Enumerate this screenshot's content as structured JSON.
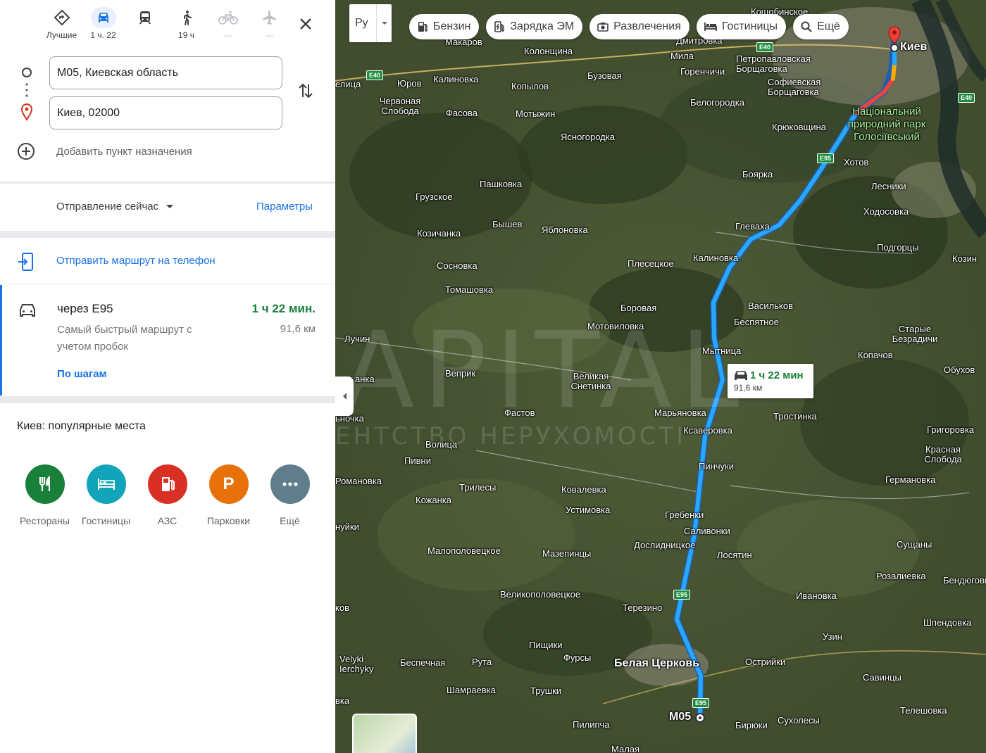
{
  "modes": [
    {
      "key": "best",
      "label": "Лучшие",
      "icon": "diamond-directions-icon",
      "selected": false,
      "dim": false
    },
    {
      "key": "car",
      "label": "1 ч. 22",
      "icon": "car-icon",
      "selected": true,
      "dim": false
    },
    {
      "key": "transit",
      "label": "",
      "icon": "train-icon",
      "selected": false,
      "dim": false
    },
    {
      "key": "walk",
      "label": "19 ч",
      "icon": "walk-icon",
      "selected": false,
      "dim": false
    },
    {
      "key": "bike",
      "label": "—",
      "icon": "bike-icon",
      "selected": false,
      "dim": true
    },
    {
      "key": "flight",
      "label": "—",
      "icon": "plane-icon",
      "selected": false,
      "dim": true
    }
  ],
  "from": {
    "value": "M05, Киевская область"
  },
  "to": {
    "value": "Киев, 02000"
  },
  "add_destination": "Добавить пункт назначения",
  "depart": {
    "label": "Отправление сейчас",
    "params": "Параметры"
  },
  "send_to_phone": "Отправить маршрут на телефон",
  "route": {
    "via": "через E95",
    "time": "1 ч 22 мин.",
    "description": "Самый быстрый маршрут с учетом пробок",
    "distance": "91,6 км",
    "steps": "По шагам"
  },
  "popular": {
    "title": "Киев: популярные места",
    "categories": [
      {
        "label": "Рестораны",
        "color": "#188038",
        "icon": "restaurant-icon"
      },
      {
        "label": "Гостиницы",
        "color": "#12a4b9",
        "icon": "hotel-icon"
      },
      {
        "label": "АЗС",
        "color": "#d93025",
        "icon": "gas-station-icon"
      },
      {
        "label": "Парковки",
        "color": "#e8710a",
        "icon": "parking-icon"
      },
      {
        "label": "Ещё",
        "color": "#607d8b",
        "icon": "more-icon"
      }
    ]
  },
  "map": {
    "lang": "Ру",
    "chips": [
      {
        "label": "Бензин",
        "icon": "gas-station-icon"
      },
      {
        "label": "Зарядка ЭМ",
        "icon": "ev-charge-icon"
      },
      {
        "label": "Развлечения",
        "icon": "camera-icon"
      },
      {
        "label": "Гостиницы",
        "icon": "hotel-icon"
      },
      {
        "label": "Ещё",
        "icon": "search-icon"
      }
    ],
    "callout": {
      "time": "1 ч 22 мин",
      "distance": "91,6 км"
    },
    "origin_label": "M05",
    "destination_label": "Киев",
    "watermark": "APITAL",
    "watermark_sub": "ЕНТСТВО НЕРУХОМОСТІ",
    "shields": [
      "E40",
      "E40",
      "E40",
      "E95",
      "E95",
      "E95"
    ],
    "places": [
      "Кощобинское",
      "Макаров",
      "Дмитровка",
      "Колонщина",
      "Мила",
      "Петропавловская Борщаговка",
      "Юров",
      "Калиновка",
      "Бузовая",
      "Горенчичи",
      "Софиевская Борщаговка",
      "елица",
      "Копылов",
      "Червоная Слобода",
      "Фасова",
      "Мотыжин",
      "Белогородка",
      "Крюковщина",
      "Ясногородка",
      "Національний природний парк Голосіївський",
      "Хотов",
      "Грузское",
      "Пашковка",
      "Боярка",
      "Лесники",
      "Ходосовка",
      "Козичанка",
      "Бышев",
      "Яблоновка",
      "Глеваха",
      "Подгорцы",
      "Сосновка",
      "Плесецкое",
      "Калиновка",
      "Томашовка",
      "Козин",
      "Боровая",
      "Васильков",
      "Мотовиловка",
      "Беспятное",
      "Старые Безрадичи",
      "Лучин",
      "Мытница",
      "Копачов",
      "Веприк",
      "Великая Снетинка",
      "Обухов",
      "анка",
      "Фастов",
      "Марьяновка",
      "Тростинка",
      "ьночка",
      "Ксаверовка",
      "Григоровка",
      "Волица",
      "Пивни",
      "Пинчуки",
      "Красная Слобода",
      "Романовка",
      "Трилесы",
      "Ковалевка",
      "Германовка",
      "Кожанка",
      "Устимовка",
      "Гребенки",
      "нуйки",
      "Саливонки",
      "Дослидницкое",
      "Сущаны",
      "Малополовецкое",
      "Мазепинцы",
      "Лосятин",
      "Розалиевка",
      "Бендюговка",
      "Великополовецкое",
      "Ивановка",
      "Терезино",
      "ков",
      "Шпендовка",
      "Пищики",
      "Узин",
      "Velyki Ierchyky",
      "Фурсы",
      "Беспечная",
      "Рута",
      "Белая Церковь",
      "Острийки",
      "Савинцы",
      "Шамраевка",
      "Трушки",
      "вка",
      "Сухолесы",
      "Телешовка",
      "Пилипча",
      "Бирюки",
      "Малая"
    ]
  }
}
